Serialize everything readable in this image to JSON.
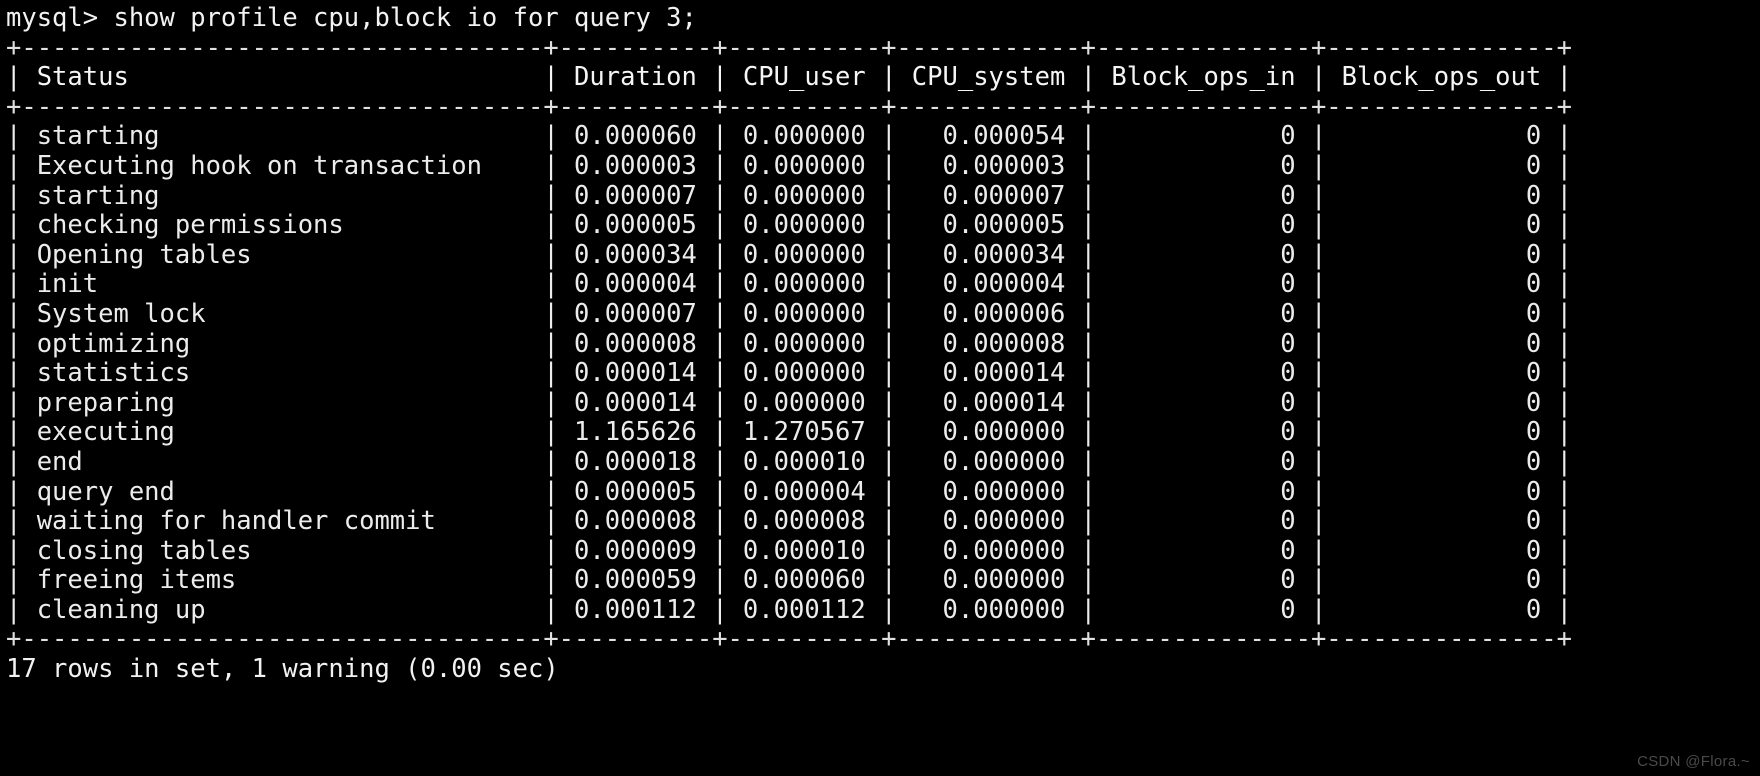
{
  "terminal": {
    "prompt": "mysql> ",
    "command": "show profile cpu,block io for query 3;",
    "prompt_line": "mysql> show profile cpu,block io for query 3;",
    "footer": "17 rows in set, 1 warning (0.00 sec)",
    "watermark": "CSDN @Flora.~",
    "background_color": "#000000",
    "text_color": "#ececec",
    "watermark_color": "#4a4a4a"
  },
  "table": {
    "border_top": "+----------------------------------+----------+----------+------------+--------------+---------------+",
    "border_header": "+----------------------------------+----------+----------+------------+--------------+---------------+",
    "border_bottom": "+----------------------------------+----------+----------+------------+--------------+---------------+",
    "header_row": "| Status                           | Duration | CPU_user | CPU_system | Block_ops_in | Block_ops_out |",
    "columns": [
      "Status",
      "Duration",
      "CPU_user",
      "CPU_system",
      "Block_ops_in",
      "Block_ops_out"
    ],
    "row_count": 17,
    "rows": [
      {
        "status": "starting",
        "duration": "0.000060",
        "cpu_user": "0.000000",
        "cpu_system": "0.000054",
        "block_ops_in": "0",
        "block_ops_out": "0",
        "text": "| starting                         | 0.000060 | 0.000000 |   0.000054 |            0 |             0 |"
      },
      {
        "status": "Executing hook on transaction",
        "duration": "0.000003",
        "cpu_user": "0.000000",
        "cpu_system": "0.000003",
        "block_ops_in": "0",
        "block_ops_out": "0",
        "text": "| Executing hook on transaction    | 0.000003 | 0.000000 |   0.000003 |            0 |             0 |"
      },
      {
        "status": "starting",
        "duration": "0.000007",
        "cpu_user": "0.000000",
        "cpu_system": "0.000007",
        "block_ops_in": "0",
        "block_ops_out": "0",
        "text": "| starting                         | 0.000007 | 0.000000 |   0.000007 |            0 |             0 |"
      },
      {
        "status": "checking permissions",
        "duration": "0.000005",
        "cpu_user": "0.000000",
        "cpu_system": "0.000005",
        "block_ops_in": "0",
        "block_ops_out": "0",
        "text": "| checking permissions             | 0.000005 | 0.000000 |   0.000005 |            0 |             0 |"
      },
      {
        "status": "Opening tables",
        "duration": "0.000034",
        "cpu_user": "0.000000",
        "cpu_system": "0.000034",
        "block_ops_in": "0",
        "block_ops_out": "0",
        "text": "| Opening tables                   | 0.000034 | 0.000000 |   0.000034 |            0 |             0 |"
      },
      {
        "status": "init",
        "duration": "0.000004",
        "cpu_user": "0.000000",
        "cpu_system": "0.000004",
        "block_ops_in": "0",
        "block_ops_out": "0",
        "text": "| init                             | 0.000004 | 0.000000 |   0.000004 |            0 |             0 |"
      },
      {
        "status": "System lock",
        "duration": "0.000007",
        "cpu_user": "0.000000",
        "cpu_system": "0.000006",
        "block_ops_in": "0",
        "block_ops_out": "0",
        "text": "| System lock                      | 0.000007 | 0.000000 |   0.000006 |            0 |             0 |"
      },
      {
        "status": "optimizing",
        "duration": "0.000008",
        "cpu_user": "0.000000",
        "cpu_system": "0.000008",
        "block_ops_in": "0",
        "block_ops_out": "0",
        "text": "| optimizing                       | 0.000008 | 0.000000 |   0.000008 |            0 |             0 |"
      },
      {
        "status": "statistics",
        "duration": "0.000014",
        "cpu_user": "0.000000",
        "cpu_system": "0.000014",
        "block_ops_in": "0",
        "block_ops_out": "0",
        "text": "| statistics                       | 0.000014 | 0.000000 |   0.000014 |            0 |             0 |"
      },
      {
        "status": "preparing",
        "duration": "0.000014",
        "cpu_user": "0.000000",
        "cpu_system": "0.000014",
        "block_ops_in": "0",
        "block_ops_out": "0",
        "text": "| preparing                        | 0.000014 | 0.000000 |   0.000014 |            0 |             0 |"
      },
      {
        "status": "executing",
        "duration": "1.165626",
        "cpu_user": "1.270567",
        "cpu_system": "0.000000",
        "block_ops_in": "0",
        "block_ops_out": "0",
        "text": "| executing                        | 1.165626 | 1.270567 |   0.000000 |            0 |             0 |"
      },
      {
        "status": "end",
        "duration": "0.000018",
        "cpu_user": "0.000010",
        "cpu_system": "0.000000",
        "block_ops_in": "0",
        "block_ops_out": "0",
        "text": "| end                              | 0.000018 | 0.000010 |   0.000000 |            0 |             0 |"
      },
      {
        "status": "query end",
        "duration": "0.000005",
        "cpu_user": "0.000004",
        "cpu_system": "0.000000",
        "block_ops_in": "0",
        "block_ops_out": "0",
        "text": "| query end                        | 0.000005 | 0.000004 |   0.000000 |            0 |             0 |"
      },
      {
        "status": "waiting for handler commit",
        "duration": "0.000008",
        "cpu_user": "0.000008",
        "cpu_system": "0.000000",
        "block_ops_in": "0",
        "block_ops_out": "0",
        "text": "| waiting for handler commit       | 0.000008 | 0.000008 |   0.000000 |            0 |             0 |"
      },
      {
        "status": "closing tables",
        "duration": "0.000009",
        "cpu_user": "0.000010",
        "cpu_system": "0.000000",
        "block_ops_in": "0",
        "block_ops_out": "0",
        "text": "| closing tables                   | 0.000009 | 0.000010 |   0.000000 |            0 |             0 |"
      },
      {
        "status": "freeing items",
        "duration": "0.000059",
        "cpu_user": "0.000060",
        "cpu_system": "0.000000",
        "block_ops_in": "0",
        "block_ops_out": "0",
        "text": "| freeing items                    | 0.000059 | 0.000060 |   0.000000 |            0 |             0 |"
      },
      {
        "status": "cleaning up",
        "duration": "0.000112",
        "cpu_user": "0.000112",
        "cpu_system": "0.000000",
        "block_ops_in": "0",
        "block_ops_out": "0",
        "text": "| cleaning up                      | 0.000112 | 0.000112 |   0.000000 |            0 |             0 |"
      }
    ]
  }
}
